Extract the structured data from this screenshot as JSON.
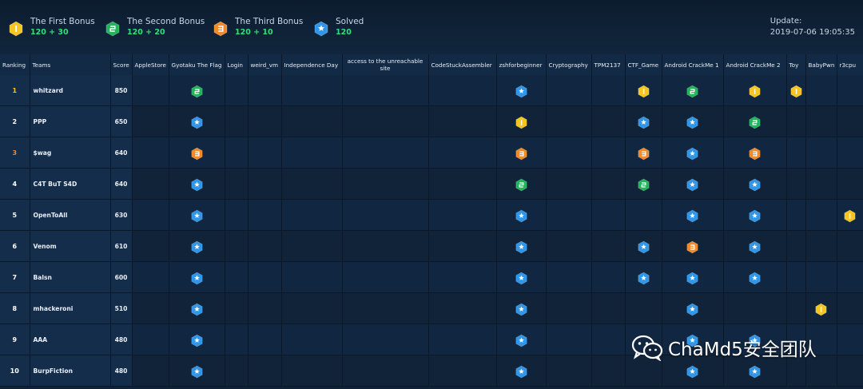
{
  "legend": [
    {
      "type": "gold",
      "name": "The First Bonus",
      "points": "120 + 30"
    },
    {
      "type": "green",
      "name": "The Second Bonus",
      "points": "120 + 20"
    },
    {
      "type": "orange",
      "name": "The Third Bonus",
      "points": "120 + 10"
    },
    {
      "type": "blue",
      "name": "Solved",
      "points": "120"
    }
  ],
  "update": {
    "label": "Update:",
    "time": "2019-07-06 19:05:35"
  },
  "columns": [
    "Ranking",
    "Teams",
    "Score",
    "AppleStore",
    "Gyotaku The Flag",
    "Login",
    "weird_vm",
    "Independence Day",
    "access to the unreachable site",
    "CodeStuckAssembler",
    "zshforbeginner",
    "Cryptography",
    "TPM2137",
    "CTF_Game",
    "Android CrackMe 1",
    "Android CrackMe 2",
    "Toy",
    "BabyPwn",
    "r3cpu"
  ],
  "rows": [
    {
      "rank": "1",
      "team": "whitzard",
      "score": "850",
      "solves": {
        "Gyotaku The Flag": "green",
        "zshforbeginner": "blue",
        "CTF_Game": "gold",
        "Android CrackMe 1": "green",
        "Android CrackMe 2": "gold",
        "Toy": "gold"
      }
    },
    {
      "rank": "2",
      "team": "PPP",
      "score": "650",
      "solves": {
        "Gyotaku The Flag": "blue",
        "zshforbeginner": "gold",
        "CTF_Game": "blue",
        "Android CrackMe 1": "blue",
        "Android CrackMe 2": "green"
      }
    },
    {
      "rank": "3",
      "team": "$wag",
      "score": "640",
      "solves": {
        "Gyotaku The Flag": "orange",
        "zshforbeginner": "orange",
        "CTF_Game": "orange",
        "Android CrackMe 1": "blue",
        "Android CrackMe 2": "orange"
      }
    },
    {
      "rank": "4",
      "team": "C4T BuT S4D",
      "score": "640",
      "solves": {
        "Gyotaku The Flag": "blue",
        "zshforbeginner": "green",
        "CTF_Game": "green",
        "Android CrackMe 1": "blue",
        "Android CrackMe 2": "blue"
      }
    },
    {
      "rank": "5",
      "team": "OpenToAll",
      "score": "630",
      "solves": {
        "Gyotaku The Flag": "blue",
        "zshforbeginner": "blue",
        "Android CrackMe 1": "blue",
        "Android CrackMe 2": "blue",
        "r3cpu": "gold"
      }
    },
    {
      "rank": "6",
      "team": "Venom",
      "score": "610",
      "solves": {
        "Gyotaku The Flag": "blue",
        "zshforbeginner": "blue",
        "CTF_Game": "blue",
        "Android CrackMe 1": "orange",
        "Android CrackMe 2": "blue"
      }
    },
    {
      "rank": "7",
      "team": "Balsn",
      "score": "600",
      "solves": {
        "Gyotaku The Flag": "blue",
        "zshforbeginner": "blue",
        "CTF_Game": "blue",
        "Android CrackMe 1": "blue",
        "Android CrackMe 2": "blue"
      }
    },
    {
      "rank": "8",
      "team": "mhackeroni",
      "score": "510",
      "solves": {
        "Gyotaku The Flag": "blue",
        "zshforbeginner": "blue",
        "Android CrackMe 1": "blue",
        "BabyPwn": "gold"
      }
    },
    {
      "rank": "9",
      "team": "AAA",
      "score": "480",
      "solves": {
        "Gyotaku The Flag": "blue",
        "zshforbeginner": "blue",
        "Android CrackMe 1": "blue",
        "Android CrackMe 2": "blue"
      }
    },
    {
      "rank": "10",
      "team": "BurpFiction",
      "score": "480",
      "solves": {
        "Gyotaku The Flag": "blue",
        "zshforbeginner": "blue",
        "Android CrackMe 1": "blue",
        "Android CrackMe 2": "blue"
      }
    }
  ],
  "colors": {
    "gold": "#f5c521",
    "green": "#22b45a",
    "orange": "#f28a2a",
    "blue": "#2f96ea"
  },
  "icons": {
    "gold": "first-bonus-badge-icon",
    "green": "second-bonus-badge-icon",
    "orange": "third-bonus-badge-icon",
    "blue": "solved-badge-icon"
  },
  "watermark": {
    "text": "ChaMd5安全团队"
  }
}
